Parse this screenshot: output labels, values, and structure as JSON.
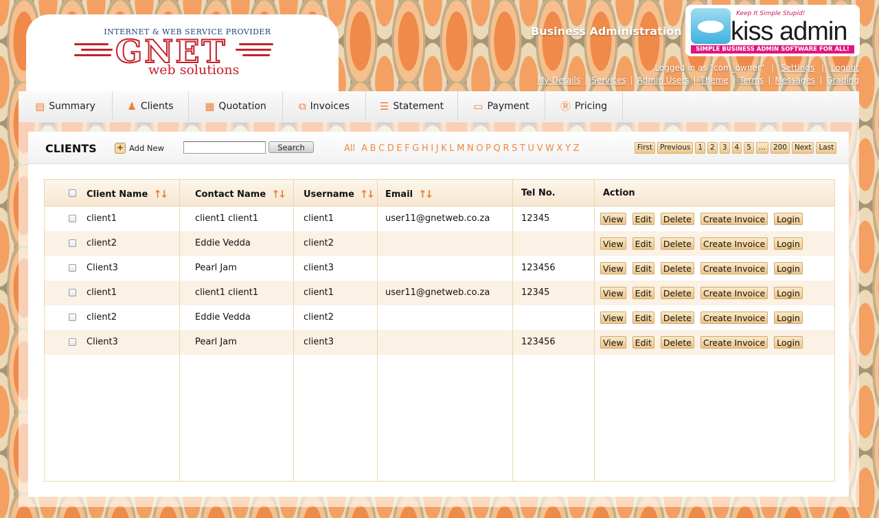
{
  "brand": {
    "tagline": "INTERNET & WEB SERVICE PROVIDER",
    "name": "GNET",
    "subname": "web solutions"
  },
  "header": {
    "title": "Business Administration",
    "product": {
      "tagline": "Keep It Simple Stupid!",
      "name": "kiss admin",
      "strap": "SIMPLE BUSINESS ADMIN SOFTWARE FOR ALL!"
    },
    "user": {
      "logged_in": "Logged in as \"com_owner\"",
      "settings": "Settings",
      "logout": "Logout"
    },
    "links": {
      "my_details": "My Details",
      "services": "Services",
      "admin_users": "Admin Users",
      "theme": "Theme",
      "terms": "Terms",
      "messages": "Messages",
      "grading": "Grading"
    }
  },
  "nav": [
    {
      "label": "Summary",
      "icon": "chart-icon"
    },
    {
      "label": "Clients",
      "icon": "user-icon"
    },
    {
      "label": "Quotation",
      "icon": "calculator-icon"
    },
    {
      "label": "Invoices",
      "icon": "documents-icon"
    },
    {
      "label": "Statement",
      "icon": "statement-icon"
    },
    {
      "label": "Payment",
      "icon": "credit-card-icon"
    },
    {
      "label": "Pricing",
      "icon": "pricing-icon"
    }
  ],
  "clients": {
    "title": "CLIENTS",
    "add_new": "Add New",
    "search_value": "",
    "search_button": "Search",
    "alphabet": [
      "All",
      "A",
      "B",
      "C",
      "D",
      "E",
      "F",
      "G",
      "H",
      "I",
      "J",
      "K",
      "L",
      "M",
      "N",
      "O",
      "P",
      "Q",
      "R",
      "S",
      "T",
      "U",
      "V",
      "W",
      "X",
      "Y",
      "Z"
    ],
    "pager": [
      "First",
      "Previous",
      "1",
      "2",
      "3",
      "4",
      "5",
      "...",
      "200",
      "Next",
      "Last"
    ],
    "columns": {
      "client_name": "Client Name",
      "contact_name": "Contact Name",
      "username": "Username",
      "email": "Email",
      "tel": "Tel No.",
      "action": "Action"
    },
    "action_labels": {
      "view": "View",
      "edit": "Edit",
      "delete": "Delete",
      "create_invoice": "Create Invoice",
      "login": "Login"
    },
    "rows": [
      {
        "client": "client1",
        "contact": "client1 client1",
        "username": "client1",
        "email": "user11@gnetweb.co.za",
        "tel": "12345"
      },
      {
        "client": "client2",
        "contact": "Eddie Vedda",
        "username": "client2",
        "email": "",
        "tel": ""
      },
      {
        "client": "Client3",
        "contact": "Pearl Jam",
        "username": "client3",
        "email": "",
        "tel": "123456"
      },
      {
        "client": "client1",
        "contact": "client1 client1",
        "username": "client1",
        "email": "user11@gnetweb.co.za",
        "tel": "12345"
      },
      {
        "client": "client2",
        "contact": "Eddie Vedda",
        "username": "client2",
        "email": "",
        "tel": ""
      },
      {
        "client": "Client3",
        "contact": "Pearl Jam",
        "username": "client3",
        "email": "",
        "tel": "123456"
      }
    ]
  },
  "colors": {
    "accent": "#f07d36",
    "logo_red": "#c3202a",
    "button_fill": "#ebc489",
    "row_alt": "#fbf1e4"
  }
}
